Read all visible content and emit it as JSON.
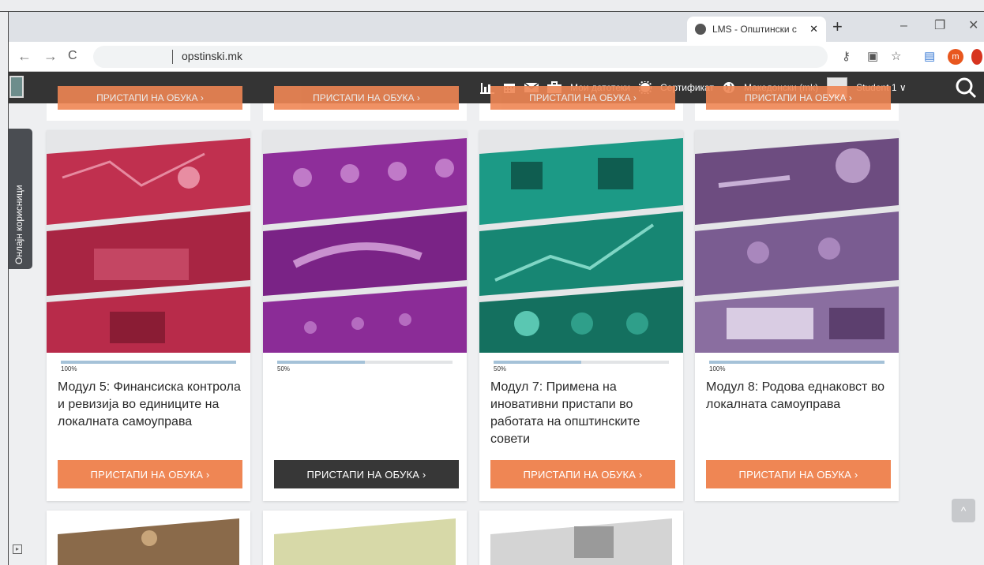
{
  "browser": {
    "tab_title": "LMS - Општински с",
    "tab_close": "✕",
    "new_tab": "+",
    "minimize": "–",
    "restore": "❐",
    "close": "✕",
    "back": "←",
    "forward": "→",
    "reload": "C",
    "url": "opstinski.mk",
    "ext_red_label": "m"
  },
  "header": {
    "my_files": "Мои датотеки",
    "certificate": "Сертификат",
    "language": "Македонски (mk)",
    "user": "Student 1",
    "user_caret": "∨"
  },
  "sidebar": {
    "online_users": "Онлајн корисници"
  },
  "top_buttons": [
    "ПРИСТАПИ НА ОБУКА ›",
    "ПРИСТАПИ НА ОБУКА ›",
    "ПРИСТАПИ НА ОБУКА ›",
    "ПРИСТАПИ НА ОБУКА ›"
  ],
  "cards": [
    {
      "percent_label": "100%",
      "progress": 1.0,
      "title": "Модул 5: Финансиска контрола и ревизија во единиците на локалната самоуправа",
      "button": "ПРИСТАПИ НА ОБУКА ›",
      "tint": "#c0304f",
      "button_style": "orange"
    },
    {
      "percent_label": "50%",
      "progress": 0.5,
      "title": "",
      "button": "ПРИСТАПИ НА ОБУКА ›",
      "tint": "#8e2e9a",
      "button_style": "dark"
    },
    {
      "percent_label": "50%",
      "progress": 0.5,
      "title": "Модул 7: Примена на иновативни пристапи во работата на општинските совети",
      "button": "ПРИСТАПИ НА ОБУКА ›",
      "tint": "#1c9a86",
      "button_style": "orange"
    },
    {
      "percent_label": "100%",
      "progress": 1.0,
      "title": "Модул 8: Родова еднаковст во локалната самоуправа",
      "button": "ПРИСТАПИ НА ОБУКА ›",
      "tint": "#7a5c91",
      "button_style": "orange"
    }
  ],
  "colors": {
    "accent": "#ef8654",
    "header_bg": "#343434",
    "progress": "#a5c2d8"
  },
  "scroll_top_icon": "^"
}
